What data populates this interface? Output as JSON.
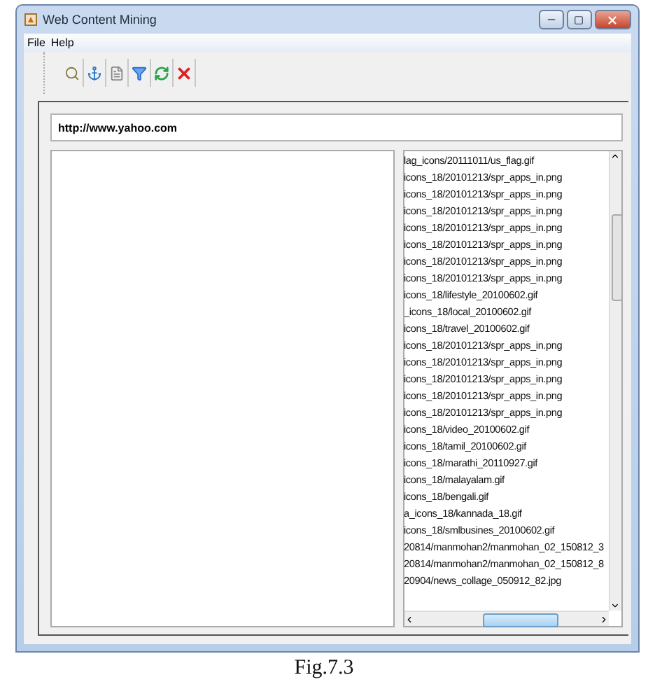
{
  "window": {
    "title": "Web Content Mining"
  },
  "menu": [
    "File",
    "Help"
  ],
  "url_field": {
    "value": "http://www.yahoo.com"
  },
  "links_list": [
    "lag_icons/20111011/us_flag.gif",
    "icons_18/20101213/spr_apps_in.png",
    "icons_18/20101213/spr_apps_in.png",
    "icons_18/20101213/spr_apps_in.png",
    "icons_18/20101213/spr_apps_in.png",
    "icons_18/20101213/spr_apps_in.png",
    "icons_18/20101213/spr_apps_in.png",
    "icons_18/20101213/spr_apps_in.png",
    "icons_18/lifestyle_20100602.gif",
    "_icons_18/local_20100602.gif",
    "icons_18/travel_20100602.gif",
    "icons_18/20101213/spr_apps_in.png",
    "icons_18/20101213/spr_apps_in.png",
    "icons_18/20101213/spr_apps_in.png",
    "icons_18/20101213/spr_apps_in.png",
    "icons_18/20101213/spr_apps_in.png",
    "icons_18/video_20100602.gif",
    "icons_18/tamil_20100602.gif",
    "icons_18/marathi_20110927.gif",
    "icons_18/malayalam.gif",
    "icons_18/bengali.gif",
    "a_icons_18/kannada_18.gif",
    "icons_18/smlbusines_20100602.gif",
    "20814/manmohan2/manmohan_02_150812_3",
    "20814/manmohan2/manmohan_02_150812_8",
    "20904/news_collage_050912_82.jpg"
  ],
  "caption": "Fig.7.3"
}
